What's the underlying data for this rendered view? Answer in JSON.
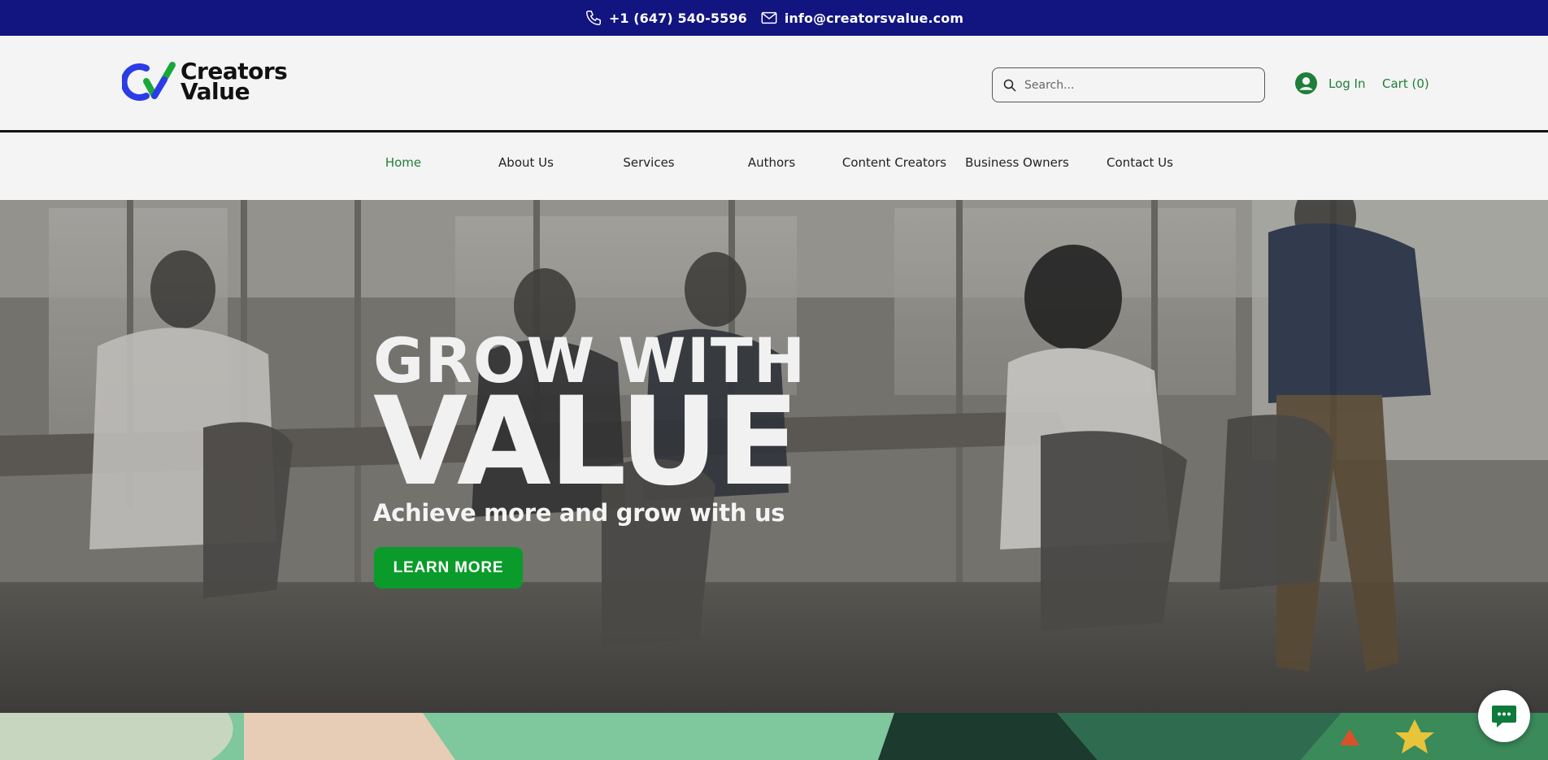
{
  "topbar": {
    "phone": "+1 (647) 540-5596",
    "email": "info@creatorsvalue.com",
    "phone_icon": "phone-icon",
    "email_icon": "mail-icon"
  },
  "header": {
    "logo_line1": "Creators",
    "logo_line2": "Value",
    "search_placeholder": "Search...",
    "login_label": "Log In",
    "cart_label": "Cart (0)"
  },
  "nav": {
    "items": [
      {
        "label": "Home",
        "active": true
      },
      {
        "label": "About Us"
      },
      {
        "label": "Services"
      },
      {
        "label": "Authors"
      },
      {
        "label": "Content Creators"
      },
      {
        "label": "Business Owners"
      },
      {
        "label": "Contact Us"
      }
    ]
  },
  "hero": {
    "headline_top": "GROW WITH",
    "headline_main": "VALUE",
    "subtitle": "Achieve more and grow with us",
    "cta_label": "LEARN MORE"
  },
  "colors": {
    "topbar_bg": "#121480",
    "accent_green": "#0a9b2a",
    "link_green": "#1e7f3a",
    "logo_blue": "#2b3ce6",
    "logo_green": "#17a83a"
  }
}
